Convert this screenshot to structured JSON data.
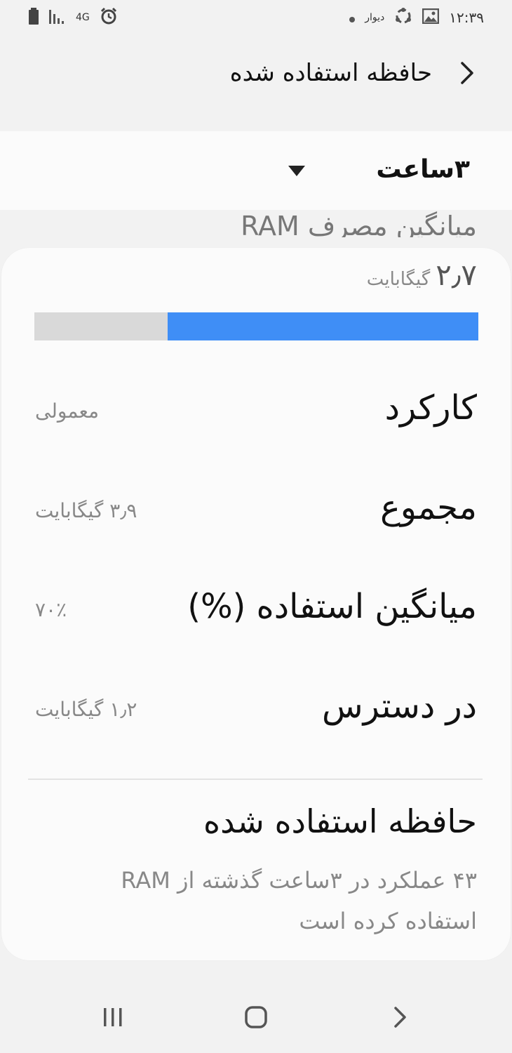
{
  "status_bar": {
    "time": "۱۲:۳۹",
    "notification_app": "دیوار",
    "network": "4G",
    "icons": [
      "battery-icon",
      "signal-icon",
      "network-4g-icon",
      "alarm-icon",
      "dot-icon",
      "app-notification-icon",
      "sync-icon",
      "image-icon"
    ]
  },
  "header": {
    "title": "حافظه استفاده شده"
  },
  "filter": {
    "selected": "۳ساعت"
  },
  "ram": {
    "section_title": "میانگین مصرف RAM",
    "used_value": "۲٫۷",
    "used_unit": "گیگابایت",
    "usage_fraction": 0.7
  },
  "stats": [
    {
      "label": "کارکرد",
      "value": "معمولی"
    },
    {
      "label": "مجموع",
      "value": "۳٫۹ گیگابایت"
    },
    {
      "label": "میانگین استفاده (%)",
      "value": "۷۰٪"
    },
    {
      "label": "در دسترس",
      "value": "۱٫۲ گیگابایت"
    }
  ],
  "used_memory": {
    "title": "حافظه استفاده شده",
    "description": "۴۳ عملکرد در ۳ساعت گذشته از RAM استفاده کرده است"
  },
  "colors": {
    "accent": "#3f8ef6",
    "bar_track": "#d9d9d9",
    "background": "#f2f2f2",
    "card": "#fbfbfb"
  },
  "nav_bar": {
    "icons": [
      "recent-apps-icon",
      "home-icon",
      "back-icon"
    ]
  }
}
